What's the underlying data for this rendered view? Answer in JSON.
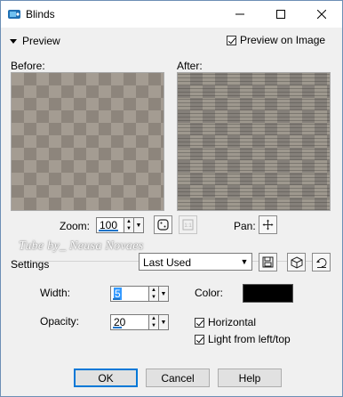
{
  "window": {
    "title": "Blinds"
  },
  "preview": {
    "toggle_label": "Preview",
    "on_image_label": "Preview on Image",
    "on_image_checked": true
  },
  "panes": {
    "before_label": "Before:",
    "after_label": "After:"
  },
  "zoom": {
    "label": "Zoom:",
    "value": "100"
  },
  "pan": {
    "label": "Pan:"
  },
  "watermark": "Tube by_ Neusa Novaes",
  "settings": {
    "label": "Settings",
    "preset_value": "Last Used"
  },
  "width": {
    "label": "Width:",
    "value": "5"
  },
  "opacity": {
    "label": "Opacity:",
    "value": "20"
  },
  "color": {
    "label": "Color:",
    "value": "#000000"
  },
  "options": {
    "horizontal_label": "Horizontal",
    "horizontal_checked": true,
    "light_label": "Light from left/top",
    "light_checked": true
  },
  "buttons": {
    "ok": "OK",
    "cancel": "Cancel",
    "help": "Help"
  },
  "icons": {
    "app": "blinds-app-icon",
    "minimize": "minimize-icon",
    "maximize": "maximize-icon",
    "close": "close-icon",
    "zoom_fit": "zoom-fit-icon",
    "zoom_actual": "actual-size-icon",
    "pan": "pan-move-icon",
    "save_preset": "save-preset-icon",
    "randomize": "randomize-dice-icon",
    "reset": "reset-default-icon"
  }
}
